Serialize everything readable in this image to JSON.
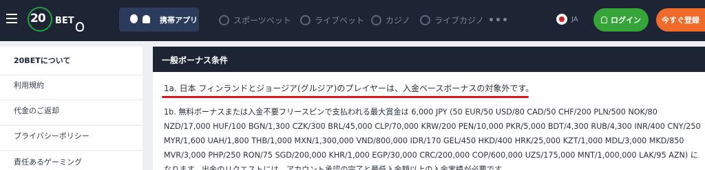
{
  "header": {
    "logo": {
      "number": "20",
      "text": "BET"
    },
    "app_button": {
      "label": "携帯アプリ"
    },
    "nav": [
      {
        "icon": "soccer-ball-icon",
        "label": "スポーツベット"
      },
      {
        "icon": "live-flame-icon",
        "label": "ライブベット"
      },
      {
        "icon": "casino-chip-icon",
        "label": "カジノ"
      },
      {
        "icon": "live-cards-icon",
        "label": "ライブカジノ"
      }
    ],
    "language": {
      "code": "JA"
    },
    "login_label": "ログイン",
    "register_label": "今すぐ登録"
  },
  "sidebar": {
    "items": [
      {
        "label": "20BETについて",
        "active": true
      },
      {
        "label": "利用規約"
      },
      {
        "label": "代金のご返却"
      },
      {
        "label": "プライバシーポリシー"
      },
      {
        "label": "責任あるゲーミング"
      }
    ]
  },
  "main": {
    "title": "一般ボーナス条件",
    "paragraph_1a": "1a. 日本 フィンランドとジョージア(グルジア)のプレイヤーは、入金ベースボーナスの対象外です。",
    "paragraph_1b": "1b. 無料ボーナスまたは入金不要フリースピンで支払われる最大賞金は 6,000 JPY (50 EUR/50 USD/80 CAD/50 CHF/200 PLN/500 NOK/80 NZD/17,000 HUF/100 BGN/1,300 CZK/300 BRL/45,000 CLP/70,000 KRW/200 PEN/10,000 PKR/5,000 BDT/4,300 RUB/4,300 INR/400 CNY/250 MYR/1,600 UAH/1,800 THB/1,000 MXN/1,300,000 VND/800,000 IDR/170 GEL/450 HKD/400 HRK/25,000 KZT/1,000 MDL/3,000 MKD/850 MVR/3,000 PHP/250 RON/75 SGD/200,000 KHR/1,000 EGP/30,000 CRC/200,000 COP/600,000 UZS/175,000 MNT/1,000,000 LAK/95 AZN) になります。出金のリクエストには、アカウント承認の完了と最低入金額以上の入金実績が必要です。"
  },
  "colors": {
    "header_bg": "#1d2534",
    "login_green": "#35a53a",
    "register_orange": "#f06a2a",
    "highlight_red": "#e1141b"
  }
}
